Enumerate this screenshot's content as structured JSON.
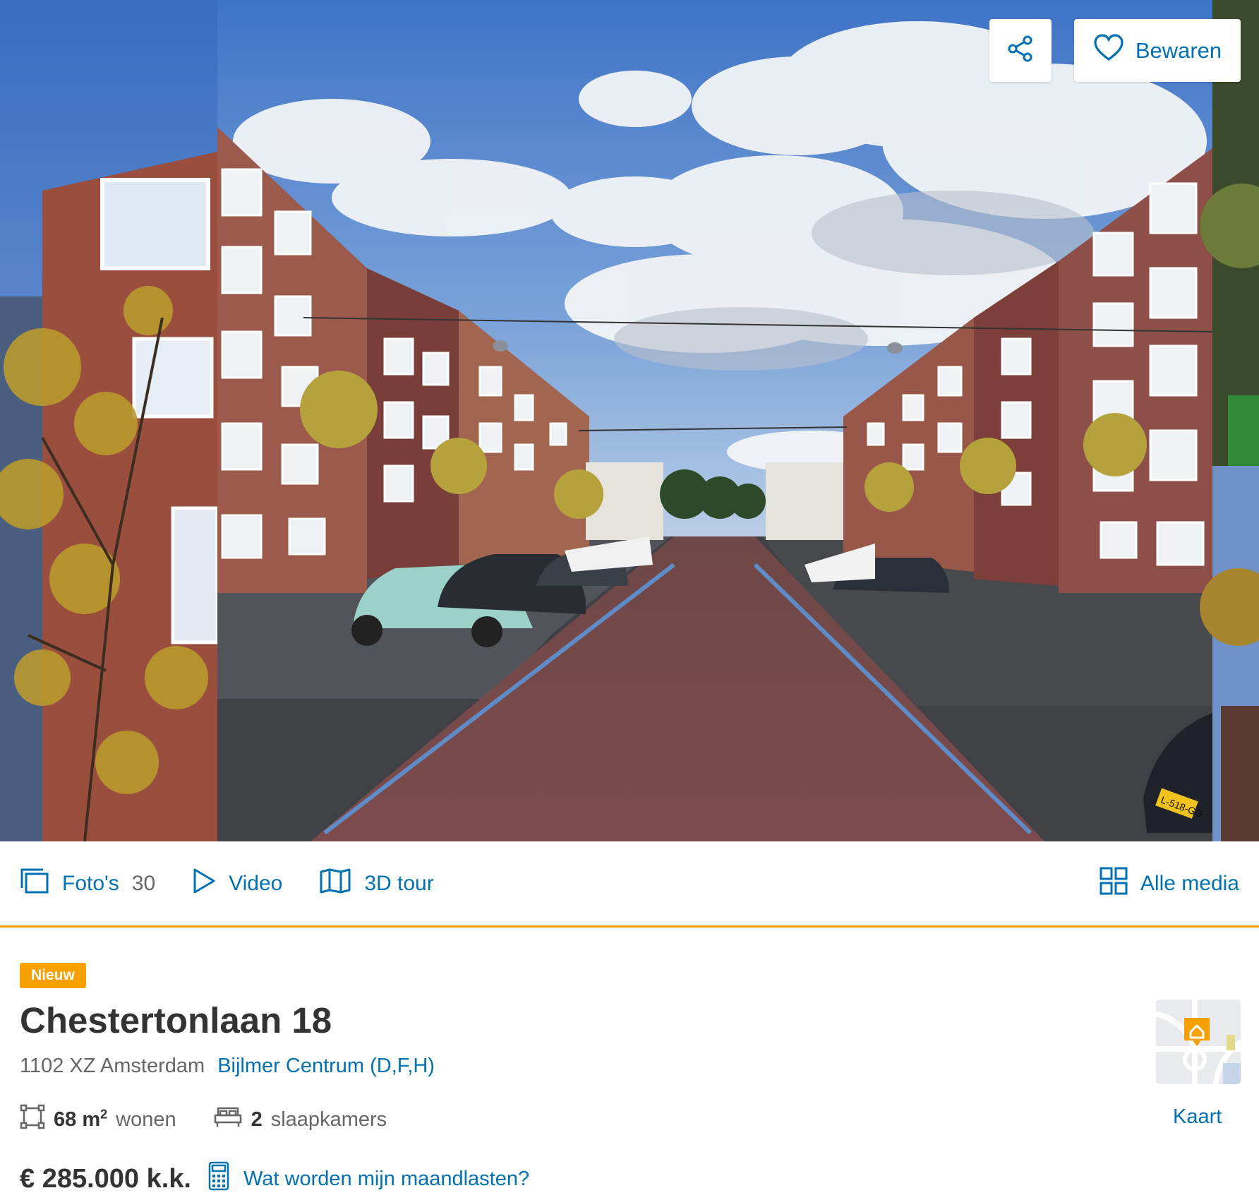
{
  "hero": {
    "share_icon": "share-icon",
    "save_icon": "heart-icon",
    "save_label": "Bewaren",
    "plate_text": "L-518-GG"
  },
  "media_bar": {
    "photos_icon": "photos-icon",
    "photos_label": "Foto's",
    "photos_count": "30",
    "video_icon": "play-icon",
    "video_label": "Video",
    "tour_icon": "3d-tour-icon",
    "tour_label": "3D tour",
    "all_media_icon": "grid-icon",
    "all_media_label": "Alle media"
  },
  "listing": {
    "badge": "Nieuw",
    "title": "Chestertonlaan 18",
    "postal_city": "1102 XZ Amsterdam",
    "neighbourhood": "Bijlmer Centrum (D,F,H)",
    "area_value": "68 m",
    "area_sup": "2",
    "area_label": "wonen",
    "bedrooms_value": "2",
    "bedrooms_label": "slaapkamers",
    "price": "€ 285.000 k.k.",
    "monthly_link": "Wat worden mijn maandlasten?",
    "map_label": "Kaart"
  },
  "colors": {
    "link_blue": "#0071b3",
    "accent_orange": "#f7a100",
    "text_dark": "#333333",
    "text_grey": "#666666"
  }
}
